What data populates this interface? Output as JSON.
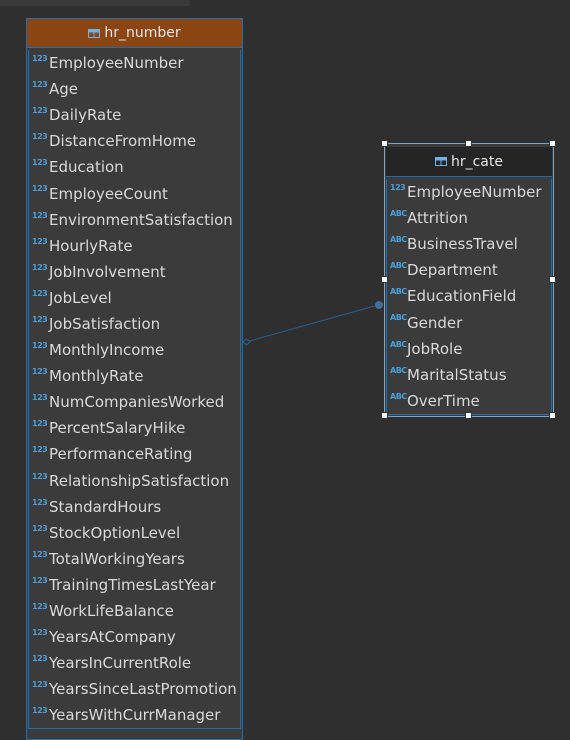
{
  "colors": {
    "accent": "#1e6fb0",
    "hr_number_header": "#8b4513",
    "hr_cate_header": "#252525",
    "numeric_icon": "#4a9fd8"
  },
  "icons": {
    "table": "table-icon",
    "numeric": "numeric-type-icon",
    "string": "string-type-icon"
  },
  "hr_number": {
    "title": "hr_number",
    "attributes": [
      {
        "icon": "123",
        "name": "EmployeeNumber"
      },
      {
        "icon": "123",
        "name": "Age"
      },
      {
        "icon": "123",
        "name": "DailyRate"
      },
      {
        "icon": "123",
        "name": "DistanceFromHome"
      },
      {
        "icon": "123",
        "name": "Education"
      },
      {
        "icon": "123",
        "name": "EmployeeCount"
      },
      {
        "icon": "123",
        "name": "EnvironmentSatisfaction"
      },
      {
        "icon": "123",
        "name": "HourlyRate"
      },
      {
        "icon": "123",
        "name": "JobInvolvement"
      },
      {
        "icon": "123",
        "name": "JobLevel"
      },
      {
        "icon": "123",
        "name": "JobSatisfaction"
      },
      {
        "icon": "123",
        "name": "MonthlyIncome"
      },
      {
        "icon": "123",
        "name": "MonthlyRate"
      },
      {
        "icon": "123",
        "name": "NumCompaniesWorked"
      },
      {
        "icon": "123",
        "name": "PercentSalaryHike"
      },
      {
        "icon": "123",
        "name": "PerformanceRating"
      },
      {
        "icon": "123",
        "name": "RelationshipSatisfaction"
      },
      {
        "icon": "123",
        "name": "StandardHours"
      },
      {
        "icon": "123",
        "name": "StockOptionLevel"
      },
      {
        "icon": "123",
        "name": "TotalWorkingYears"
      },
      {
        "icon": "123",
        "name": "TrainingTimesLastYear"
      },
      {
        "icon": "123",
        "name": "WorkLifeBalance"
      },
      {
        "icon": "123",
        "name": "YearsAtCompany"
      },
      {
        "icon": "123",
        "name": "YearsInCurrentRole"
      },
      {
        "icon": "123",
        "name": "YearsSinceLastPromotion"
      },
      {
        "icon": "123",
        "name": "YearsWithCurrManager"
      }
    ]
  },
  "hr_cate": {
    "title": "hr_cate",
    "attributes": [
      {
        "icon": "123",
        "name": "EmployeeNumber"
      },
      {
        "icon": "ABC",
        "name": "Attrition"
      },
      {
        "icon": "ABC",
        "name": "BusinessTravel"
      },
      {
        "icon": "ABC",
        "name": "Department"
      },
      {
        "icon": "ABC",
        "name": "EducationField"
      },
      {
        "icon": "ABC",
        "name": "Gender"
      },
      {
        "icon": "ABC",
        "name": "JobRole"
      },
      {
        "icon": "ABC",
        "name": "MaritalStatus"
      },
      {
        "icon": "ABC",
        "name": "OverTime"
      }
    ]
  }
}
